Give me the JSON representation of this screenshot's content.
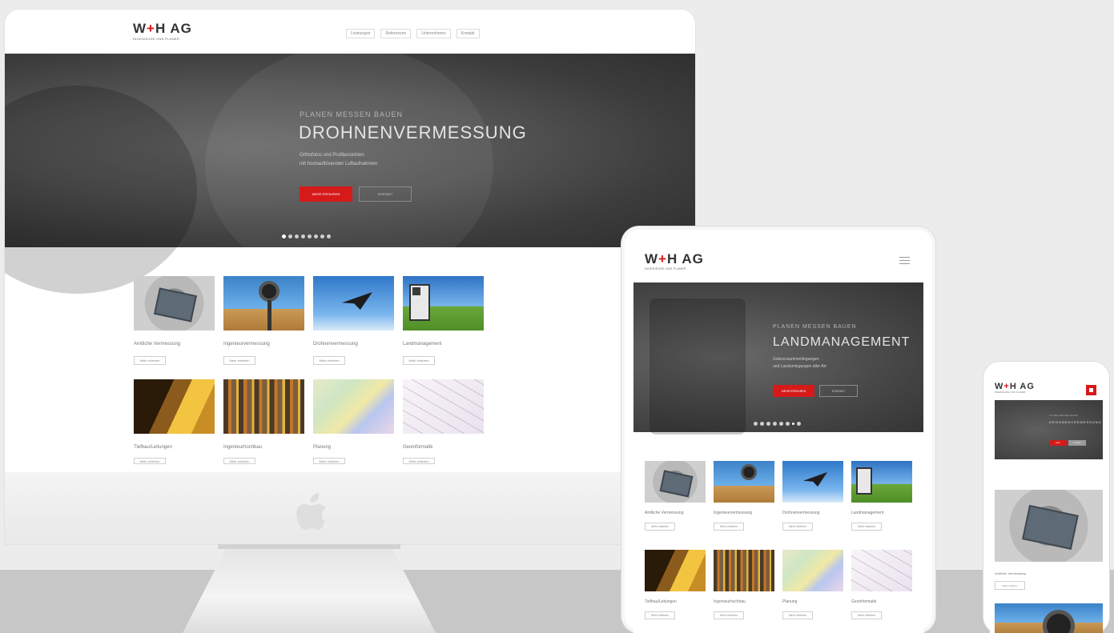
{
  "brand": {
    "logo_mark": "W·H AG",
    "logo_prefix": "W",
    "logo_cross": "+",
    "logo_suffix": "H AG",
    "tagline": "INGENIEURE UND PLANER",
    "accent_color": "#d61a1a"
  },
  "desktop": {
    "nav": [
      "Leistungen",
      "Referenzen",
      "Unternehmen",
      "Kontakt"
    ],
    "hero": {
      "kicker": "PLANEN MESSEN BAUEN",
      "title": "DROHNENVERMESSUNG",
      "text_line1": "Orthofotos und Profilansichten",
      "text_line2": "mit hochauflösenden Luftaufnahmen",
      "primary_button": "MEHR ERFAHREN",
      "secondary_button": "KONTAKT",
      "slide_count": 8,
      "active_slide": 1
    },
    "services": [
      {
        "label": "Amtliche Vermessung",
        "button": "Mehr erfahren",
        "thumb": "manhole-cover-image"
      },
      {
        "label": "Ingenieurvermessung",
        "button": "Mehr erfahren",
        "thumb": "survey-instrument-image"
      },
      {
        "label": "Drohnenvermessung",
        "button": "Mehr erfahren",
        "thumb": "survey-drone-image"
      },
      {
        "label": "Landmanagement",
        "button": "Mehr erfahren",
        "thumb": "total-station-image"
      },
      {
        "label": "Tiefbau/Leitungen",
        "button": "Mehr erfahren",
        "thumb": "trench-image"
      },
      {
        "label": "Ingenieurhochbau",
        "button": "Mehr erfahren",
        "thumb": "construction-site-image"
      },
      {
        "label": "Planung",
        "button": "Mehr erfahren",
        "thumb": "planning-map-image"
      },
      {
        "label": "Geoinformatik",
        "button": "Mehr erfahren",
        "thumb": "geoinformatics-image"
      }
    ]
  },
  "tablet": {
    "hero": {
      "kicker": "PLANEN MESSEN BAUEN",
      "title": "LANDMANAGEMENT",
      "text_line1": "Güterzusammenlegungen",
      "text_line2": "und Landumlegungen aller Art",
      "primary_button": "MEHR ERFAHREN",
      "secondary_button": "KONTAKT",
      "slide_count": 8,
      "active_slide": 7
    },
    "services": [
      {
        "label": "Amtliche Vermessung",
        "button": "Mehr erfahren"
      },
      {
        "label": "Ingenieurvermessung",
        "button": "Mehr erfahren"
      },
      {
        "label": "Drohnenvermessung",
        "button": "Mehr erfahren"
      },
      {
        "label": "Landmanagement",
        "button": "Mehr erfahren"
      },
      {
        "label": "Tiefbau/Leitungen",
        "button": "Mehr erfahren"
      },
      {
        "label": "Ingenieurhochbau",
        "button": "Mehr erfahren"
      },
      {
        "label": "Planung",
        "button": "Mehr erfahren"
      },
      {
        "label": "Geoinformatik",
        "button": "Mehr erfahren"
      }
    ]
  },
  "phone": {
    "hero": {
      "kicker": "PLANEN MESSEN BAUEN",
      "title": "DROHNENVERMESSUNG",
      "primary_button": "MEHR",
      "secondary_button": "KONTAKT"
    },
    "service": {
      "label": "Amtliche Vermessung",
      "button": "Mehr erfahren"
    }
  }
}
